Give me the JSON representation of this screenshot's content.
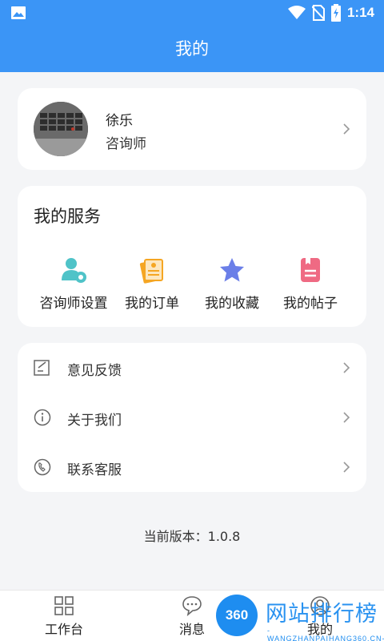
{
  "status_bar": {
    "time": "1:14"
  },
  "header": {
    "title": "我的"
  },
  "profile": {
    "name": "徐乐",
    "role": "咨询师"
  },
  "services": {
    "title": "我的服务",
    "items": [
      {
        "label": "咨询师设置",
        "icon": "counselor-settings-icon",
        "color": "#4fc3c8"
      },
      {
        "label": "我的订单",
        "icon": "order-icon",
        "color": "#f5a623"
      },
      {
        "label": "我的收藏",
        "icon": "star-icon",
        "color": "#6b7fe8"
      },
      {
        "label": "我的帖子",
        "icon": "post-icon",
        "color": "#ef6a83"
      }
    ]
  },
  "menu": [
    {
      "label": "意见反馈",
      "icon": "feedback-icon"
    },
    {
      "label": "关于我们",
      "icon": "info-icon"
    },
    {
      "label": "联系客服",
      "icon": "phone-icon"
    }
  ],
  "version": {
    "text": "当前版本：1.0.8"
  },
  "tabbar": [
    {
      "label": "工作台",
      "icon": "grid-icon"
    },
    {
      "label": "消息",
      "icon": "chat-icon"
    },
    {
      "label": "我的",
      "icon": "user-icon"
    }
  ],
  "watermark": {
    "badge": "360",
    "text": "网站排行榜",
    "sub": "-WANGZHANPAIHANG360.CN-"
  },
  "colors": {
    "primary": "#3b95f6",
    "background": "#f4f5f7"
  }
}
